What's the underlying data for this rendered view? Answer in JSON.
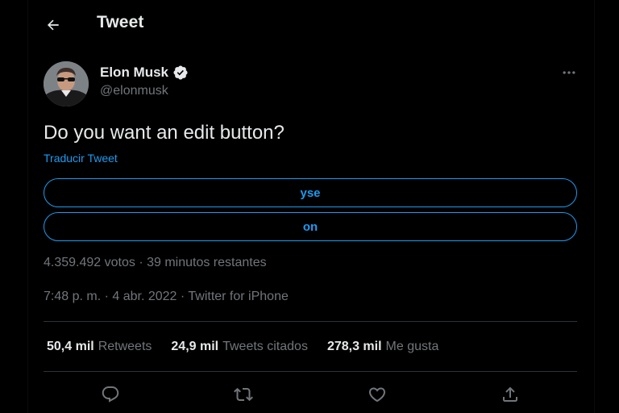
{
  "header": {
    "title": "Tweet",
    "back_icon": "arrow-left-icon"
  },
  "author": {
    "name": "Elon Musk",
    "handle": "@elonmusk",
    "verified_icon": "verified-badge-icon",
    "more_icon": "more-horizontal-icon"
  },
  "tweet": {
    "text": "Do you want an edit button?",
    "translate_label": "Traducir Tweet",
    "poll": {
      "options": [
        {
          "label": "yse"
        },
        {
          "label": "on"
        }
      ],
      "meta": "4.359.492 votos · 39 minutos restantes"
    },
    "timestamp": "7:48 p. m. · 4 abr. 2022 · Twitter for iPhone"
  },
  "stats": [
    {
      "count": "50,4 mil",
      "label": "Retweets"
    },
    {
      "count": "24,9 mil",
      "label": "Tweets citados"
    },
    {
      "count": "278,3 mil",
      "label": "Me gusta"
    }
  ],
  "actions": [
    {
      "icon": "reply-icon"
    },
    {
      "icon": "retweet-icon"
    },
    {
      "icon": "like-icon"
    },
    {
      "icon": "share-icon"
    }
  ],
  "colors": {
    "background": "#000000",
    "text_primary": "#e7e9ea",
    "text_secondary": "#71767b",
    "accent": "#1d9bf0",
    "divider": "#2f3336"
  }
}
